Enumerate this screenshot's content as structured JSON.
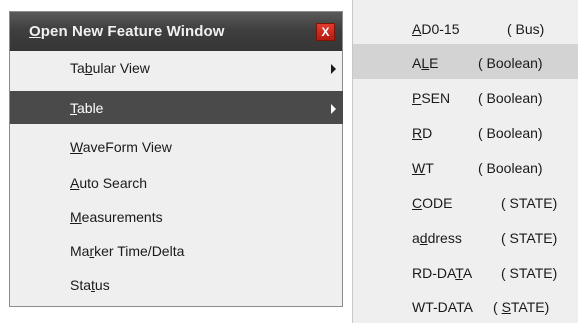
{
  "menu": {
    "title": "Open New Feature Window",
    "title_mnemonic": "O",
    "title_rest": "pen New Feature Window",
    "close_label": "X",
    "items": [
      {
        "pre": "Ta",
        "key": "b",
        "post": "ular View",
        "has_submenu": true,
        "selected": false
      },
      {
        "pre": "",
        "key": "T",
        "post": "able",
        "has_submenu": true,
        "selected": true
      },
      {
        "pre": "",
        "key": "W",
        "post": "aveForm View",
        "has_submenu": false,
        "selected": false
      },
      {
        "pre": "",
        "key": "A",
        "post": "uto Search",
        "has_submenu": false,
        "selected": false
      },
      {
        "pre": "",
        "key": "M",
        "post": "easurements",
        "has_submenu": false,
        "selected": false
      },
      {
        "pre": "Ma",
        "key": "r",
        "post": "ker Time/Delta",
        "has_submenu": false,
        "selected": false
      },
      {
        "pre": "Sta",
        "key": "t",
        "post": "us",
        "has_submenu": false,
        "selected": false
      }
    ]
  },
  "submenu": {
    "items": [
      {
        "pre": "",
        "key": "A",
        "post": "D0-15",
        "type_pre": "( Bus)",
        "type_key": "",
        "type_post": "",
        "hover": false
      },
      {
        "pre": "A",
        "key": "L",
        "post": "E",
        "type_pre": "( Boolean)",
        "type_key": "",
        "type_post": "",
        "hover": true
      },
      {
        "pre": "",
        "key": "P",
        "post": "SEN",
        "type_pre": "( Boolean)",
        "type_key": "",
        "type_post": "",
        "hover": false
      },
      {
        "pre": "",
        "key": "R",
        "post": "D",
        "type_pre": "( Boolean)",
        "type_key": "",
        "type_post": "",
        "hover": false
      },
      {
        "pre": "",
        "key": "W",
        "post": "T",
        "type_pre": "( Boolean)",
        "type_key": "",
        "type_post": "",
        "hover": false
      },
      {
        "pre": "",
        "key": "C",
        "post": "ODE",
        "type_pre": "( STATE)",
        "type_key": "",
        "type_post": "",
        "hover": false
      },
      {
        "pre": "a",
        "key": "d",
        "post": "dress",
        "type_pre": "( STATE)",
        "type_key": "",
        "type_post": "",
        "hover": false
      },
      {
        "pre": "RD-DA",
        "key": "T",
        "post": "A",
        "type_pre": "( STATE)",
        "type_key": "",
        "type_post": "",
        "hover": false
      },
      {
        "pre": "WT-DATA",
        "key": "",
        "post": "",
        "type_pre": "( ",
        "type_key": "S",
        "type_post": "TATE)",
        "hover": false
      }
    ]
  }
}
